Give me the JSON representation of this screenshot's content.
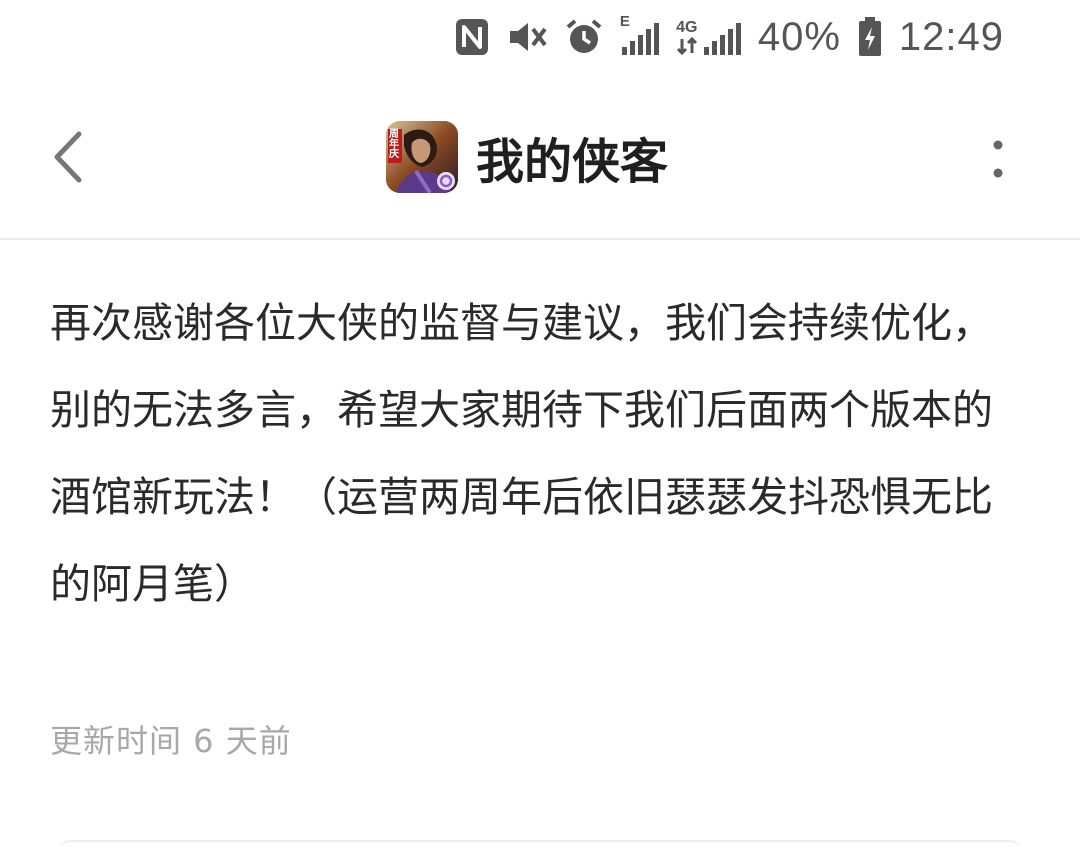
{
  "status_bar": {
    "icons": [
      "nfc-icon",
      "vibrate-icon",
      "alarm-icon",
      "signal-e-icon",
      "signal-4g-icon",
      "battery-icon"
    ],
    "network_label_1": "E",
    "network_label_2": "4G",
    "battery_percent": "40%",
    "time": "12:49"
  },
  "header": {
    "back_icon": "chevron-left-icon",
    "app_icon_badge": "周年庆",
    "title": "我的侠客",
    "more_icon": "more-vertical-icon"
  },
  "content": {
    "message": "再次感谢各位大侠的监督与建议，我们会持续优化，别的无法多言，希望大家期待下我们后面两个版本的酒馆新玩法！（运营两周年后依旧瑟瑟发抖恐惧无比的阿月笔）",
    "update_time": "更新时间 6 天前"
  }
}
